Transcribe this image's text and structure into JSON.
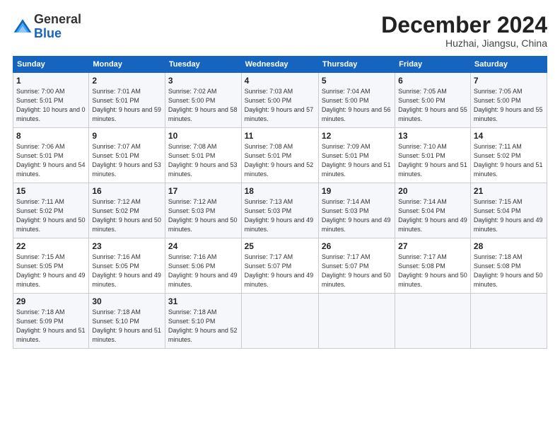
{
  "logo": {
    "general": "General",
    "blue": "Blue"
  },
  "title": "December 2024",
  "location": "Huzhai, Jiangsu, China",
  "days_of_week": [
    "Sunday",
    "Monday",
    "Tuesday",
    "Wednesday",
    "Thursday",
    "Friday",
    "Saturday"
  ],
  "weeks": [
    [
      {
        "day": 1,
        "sunrise": "7:00 AM",
        "sunset": "5:01 PM",
        "daylight": "10 hours and 0 minutes."
      },
      {
        "day": 2,
        "sunrise": "7:01 AM",
        "sunset": "5:01 PM",
        "daylight": "9 hours and 59 minutes."
      },
      {
        "day": 3,
        "sunrise": "7:02 AM",
        "sunset": "5:00 PM",
        "daylight": "9 hours and 58 minutes."
      },
      {
        "day": 4,
        "sunrise": "7:03 AM",
        "sunset": "5:00 PM",
        "daylight": "9 hours and 57 minutes."
      },
      {
        "day": 5,
        "sunrise": "7:04 AM",
        "sunset": "5:00 PM",
        "daylight": "9 hours and 56 minutes."
      },
      {
        "day": 6,
        "sunrise": "7:05 AM",
        "sunset": "5:00 PM",
        "daylight": "9 hours and 55 minutes."
      },
      {
        "day": 7,
        "sunrise": "7:05 AM",
        "sunset": "5:00 PM",
        "daylight": "9 hours and 55 minutes."
      }
    ],
    [
      {
        "day": 8,
        "sunrise": "7:06 AM",
        "sunset": "5:01 PM",
        "daylight": "9 hours and 54 minutes."
      },
      {
        "day": 9,
        "sunrise": "7:07 AM",
        "sunset": "5:01 PM",
        "daylight": "9 hours and 53 minutes."
      },
      {
        "day": 10,
        "sunrise": "7:08 AM",
        "sunset": "5:01 PM",
        "daylight": "9 hours and 53 minutes."
      },
      {
        "day": 11,
        "sunrise": "7:08 AM",
        "sunset": "5:01 PM",
        "daylight": "9 hours and 52 minutes."
      },
      {
        "day": 12,
        "sunrise": "7:09 AM",
        "sunset": "5:01 PM",
        "daylight": "9 hours and 51 minutes."
      },
      {
        "day": 13,
        "sunrise": "7:10 AM",
        "sunset": "5:01 PM",
        "daylight": "9 hours and 51 minutes."
      },
      {
        "day": 14,
        "sunrise": "7:11 AM",
        "sunset": "5:02 PM",
        "daylight": "9 hours and 51 minutes."
      }
    ],
    [
      {
        "day": 15,
        "sunrise": "7:11 AM",
        "sunset": "5:02 PM",
        "daylight": "9 hours and 50 minutes."
      },
      {
        "day": 16,
        "sunrise": "7:12 AM",
        "sunset": "5:02 PM",
        "daylight": "9 hours and 50 minutes."
      },
      {
        "day": 17,
        "sunrise": "7:12 AM",
        "sunset": "5:03 PM",
        "daylight": "9 hours and 50 minutes."
      },
      {
        "day": 18,
        "sunrise": "7:13 AM",
        "sunset": "5:03 PM",
        "daylight": "9 hours and 49 minutes."
      },
      {
        "day": 19,
        "sunrise": "7:14 AM",
        "sunset": "5:03 PM",
        "daylight": "9 hours and 49 minutes."
      },
      {
        "day": 20,
        "sunrise": "7:14 AM",
        "sunset": "5:04 PM",
        "daylight": "9 hours and 49 minutes."
      },
      {
        "day": 21,
        "sunrise": "7:15 AM",
        "sunset": "5:04 PM",
        "daylight": "9 hours and 49 minutes."
      }
    ],
    [
      {
        "day": 22,
        "sunrise": "7:15 AM",
        "sunset": "5:05 PM",
        "daylight": "9 hours and 49 minutes."
      },
      {
        "day": 23,
        "sunrise": "7:16 AM",
        "sunset": "5:05 PM",
        "daylight": "9 hours and 49 minutes."
      },
      {
        "day": 24,
        "sunrise": "7:16 AM",
        "sunset": "5:06 PM",
        "daylight": "9 hours and 49 minutes."
      },
      {
        "day": 25,
        "sunrise": "7:17 AM",
        "sunset": "5:07 PM",
        "daylight": "9 hours and 49 minutes."
      },
      {
        "day": 26,
        "sunrise": "7:17 AM",
        "sunset": "5:07 PM",
        "daylight": "9 hours and 50 minutes."
      },
      {
        "day": 27,
        "sunrise": "7:17 AM",
        "sunset": "5:08 PM",
        "daylight": "9 hours and 50 minutes."
      },
      {
        "day": 28,
        "sunrise": "7:18 AM",
        "sunset": "5:08 PM",
        "daylight": "9 hours and 50 minutes."
      }
    ],
    [
      {
        "day": 29,
        "sunrise": "7:18 AM",
        "sunset": "5:09 PM",
        "daylight": "9 hours and 51 minutes."
      },
      {
        "day": 30,
        "sunrise": "7:18 AM",
        "sunset": "5:10 PM",
        "daylight": "9 hours and 51 minutes."
      },
      {
        "day": 31,
        "sunrise": "7:18 AM",
        "sunset": "5:10 PM",
        "daylight": "9 hours and 52 minutes."
      },
      null,
      null,
      null,
      null
    ]
  ]
}
